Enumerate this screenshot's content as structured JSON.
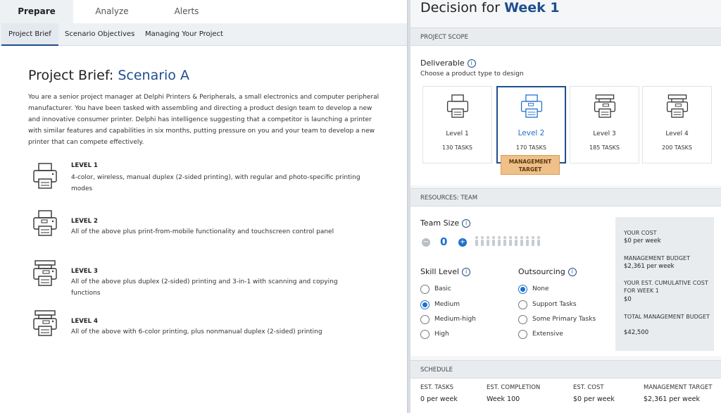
{
  "left": {
    "tabs": [
      "Prepare",
      "Analyze",
      "Alerts"
    ],
    "subtabs": [
      "Project Brief",
      "Scenario Objectives",
      "Managing Your Project"
    ],
    "brief": {
      "title_prefix": "Project Brief:",
      "title_scenario": "Scenario A",
      "intro": "You are a senior project manager at Delphi Printers & Peripherals, a small electronics and computer peripheral manufacturer. You have been tasked with assembling and directing a product design team to develop a new and innovative consumer printer. Delphi has intelligence suggesting that a competitor is launching a printer with similar features and capabilities in six months, putting pressure on you and your team to develop a new printer that can compete effectively."
    },
    "levels": [
      {
        "label": "LEVEL 1",
        "desc": "4-color, wireless, manual duplex (2-sided printing), with regular and photo-specific printing modes"
      },
      {
        "label": "LEVEL 2",
        "desc": "All of the above plus print-from-mobile functionality and touchscreen control panel"
      },
      {
        "label": "LEVEL 3",
        "desc": "All of the above plus duplex (2-sided) printing and 3-in-1 with scanning and copying functions"
      },
      {
        "label": "LEVEL 4",
        "desc": "All of the above with 6-color printing, plus nonmanual duplex (2-sided) printing"
      }
    ]
  },
  "right": {
    "title_prefix": "Decision for",
    "title_week": "Week 1",
    "scope": {
      "header": "PROJECT SCOPE",
      "deliverable_label": "Deliverable",
      "deliverable_hint": "Choose a product type to design",
      "cards": [
        {
          "name": "Level 1",
          "tasks": "130 TASKS"
        },
        {
          "name": "Level 2",
          "tasks": "170 TASKS"
        },
        {
          "name": "Level 3",
          "tasks": "185 TASKS"
        },
        {
          "name": "Level 4",
          "tasks": "200 TASKS"
        }
      ],
      "target_badge": "MANAGEMENT TARGET"
    },
    "resources": {
      "header": "RESOURCES: TEAM",
      "team_size_label": "Team Size",
      "team_size_value": "0",
      "skill_label": "Skill Level",
      "skill_options": [
        "Basic",
        "Medium",
        "Medium-high",
        "High"
      ],
      "skill_selected": "Medium",
      "outsourcing_label": "Outsourcing",
      "outsourcing_options": [
        "None",
        "Support Tasks",
        "Some Primary Tasks",
        "Extensive"
      ],
      "outsourcing_selected": "None",
      "budget": {
        "your_cost_label": "YOUR COST",
        "your_cost_value": "$0 per week",
        "mgmt_budget_label": "MANAGEMENT BUDGET",
        "mgmt_budget_value": "$2,361 per week",
        "cumulative_label": "YOUR EST. CUMULATIVE COST FOR WEEK 1",
        "cumulative_value": "$0",
        "total_label": "TOTAL MANAGEMENT BUDGET",
        "total_value": "$42,500"
      }
    },
    "schedule": {
      "header": "SCHEDULE",
      "cols": [
        {
          "label": "EST. TASKS",
          "value": "0 per week"
        },
        {
          "label": "EST. COMPLETION",
          "value": "Week 100"
        },
        {
          "label": "EST. COST",
          "value": "$0 per week"
        },
        {
          "label": "MANAGEMENT TARGET",
          "value": "$2,361 per week"
        }
      ]
    }
  },
  "colors": {
    "accent": "#1f4e8c",
    "link": "#1f6fcf",
    "target_badge": "#f0c08a"
  },
  "icons": [
    "printer-icon",
    "info-icon",
    "minus-icon",
    "plus-icon",
    "person-icon"
  ]
}
